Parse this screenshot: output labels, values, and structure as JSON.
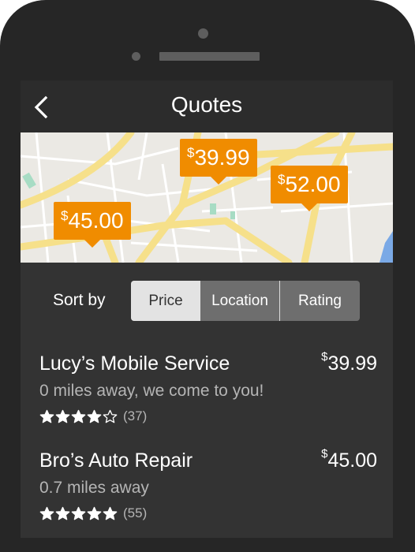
{
  "app": {
    "title": "Quotes",
    "back_icon": "chevron-left-icon",
    "accent_color": "#f08c00"
  },
  "map": {
    "pins": [
      {
        "currency": "$",
        "amount": "45.00"
      },
      {
        "currency": "$",
        "amount": "39.99"
      },
      {
        "currency": "$",
        "amount": "52.00"
      }
    ]
  },
  "sort": {
    "label": "Sort by",
    "options": [
      "Price",
      "Location",
      "Rating"
    ],
    "selected": "Price"
  },
  "quotes": [
    {
      "name": "Lucy’s Mobile Service",
      "currency": "$",
      "amount": "39.99",
      "distance": "0 miles away, we come to you!",
      "rating": 4,
      "reviews": "(37)"
    },
    {
      "name": "Bro’s Auto Repair",
      "currency": "$",
      "amount": "45.00",
      "distance": "0.7 miles away",
      "rating": 5,
      "reviews": "(55)"
    }
  ]
}
